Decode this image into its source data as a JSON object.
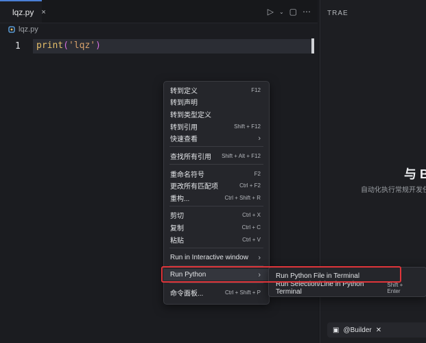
{
  "editor": {
    "tab": {
      "label": "lqz.py",
      "close": "×"
    },
    "breadcrumb": {
      "file": "lqz.py"
    },
    "code": {
      "line_number": "1",
      "fn": "print",
      "open_paren": "(",
      "string": "'lqz'",
      "close_paren": ")"
    }
  },
  "side_panel": {
    "title": "TRAE",
    "heading": "与 B",
    "subtitle": "自动化执行常规开发任务",
    "builder_label": "@Builder"
  },
  "context_menu": {
    "items": [
      {
        "label": "转到定义",
        "shortcut": "F12"
      },
      {
        "label": "转到声明",
        "shortcut": ""
      },
      {
        "label": "转到类型定义",
        "shortcut": ""
      },
      {
        "label": "转到引用",
        "shortcut": "Shift + F12"
      },
      {
        "label": "快速查看",
        "shortcut": ""
      },
      {
        "label": "查找所有引用",
        "shortcut": "Shift + Alt + F12"
      },
      {
        "label": "重命名符号",
        "shortcut": "F2"
      },
      {
        "label": "更改所有匹配项",
        "shortcut": "Ctrl + F2"
      },
      {
        "label": "重构...",
        "shortcut": "Ctrl + Shift + R"
      },
      {
        "label": "剪切",
        "shortcut": "Ctrl + X"
      },
      {
        "label": "复制",
        "shortcut": "Ctrl + C"
      },
      {
        "label": "粘贴",
        "shortcut": "Ctrl + V"
      },
      {
        "label": "Run in Interactive window",
        "shortcut": ""
      },
      {
        "label": "Run Python",
        "shortcut": ""
      },
      {
        "label": "命令面板...",
        "shortcut": "Ctrl + Shift + P"
      }
    ]
  },
  "submenu": {
    "items": [
      {
        "label": "Run Python File in Terminal",
        "shortcut": ""
      },
      {
        "label": "Run Selection/Line in Python Terminal",
        "shortcut": "Shift + Enter"
      }
    ]
  },
  "colors": {
    "accent": "#4a7fd6",
    "highlight_box": "#e0353a"
  },
  "icons": [
    "python-file-icon",
    "close-icon",
    "run-icon",
    "chevron-down-icon",
    "split-editor-icon",
    "more-icon",
    "chevron-right-icon",
    "terminal-icon",
    "tools-icon"
  ]
}
